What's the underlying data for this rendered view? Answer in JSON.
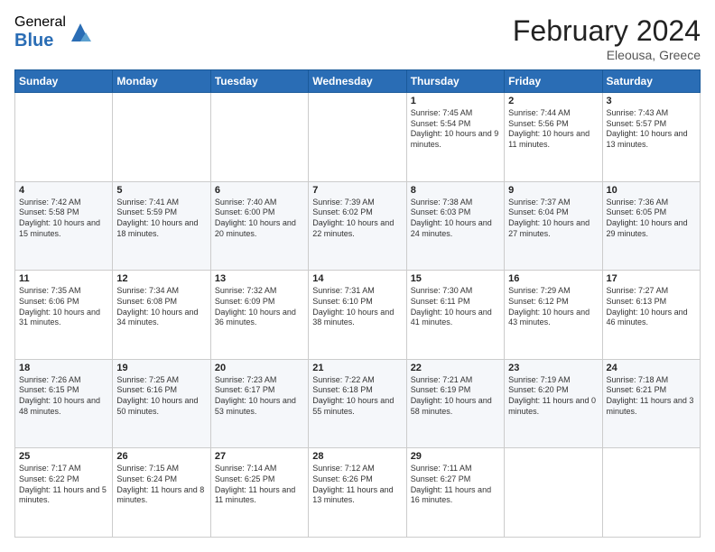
{
  "logo": {
    "general": "General",
    "blue": "Blue"
  },
  "title": "February 2024",
  "subtitle": "Eleousa, Greece",
  "days": [
    "Sunday",
    "Monday",
    "Tuesday",
    "Wednesday",
    "Thursday",
    "Friday",
    "Saturday"
  ],
  "weeks": [
    [
      {
        "num": "",
        "info": ""
      },
      {
        "num": "",
        "info": ""
      },
      {
        "num": "",
        "info": ""
      },
      {
        "num": "",
        "info": ""
      },
      {
        "num": "1",
        "info": "Sunrise: 7:45 AM\nSunset: 5:54 PM\nDaylight: 10 hours and 9 minutes."
      },
      {
        "num": "2",
        "info": "Sunrise: 7:44 AM\nSunset: 5:56 PM\nDaylight: 10 hours and 11 minutes."
      },
      {
        "num": "3",
        "info": "Sunrise: 7:43 AM\nSunset: 5:57 PM\nDaylight: 10 hours and 13 minutes."
      }
    ],
    [
      {
        "num": "4",
        "info": "Sunrise: 7:42 AM\nSunset: 5:58 PM\nDaylight: 10 hours and 15 minutes."
      },
      {
        "num": "5",
        "info": "Sunrise: 7:41 AM\nSunset: 5:59 PM\nDaylight: 10 hours and 18 minutes."
      },
      {
        "num": "6",
        "info": "Sunrise: 7:40 AM\nSunset: 6:00 PM\nDaylight: 10 hours and 20 minutes."
      },
      {
        "num": "7",
        "info": "Sunrise: 7:39 AM\nSunset: 6:02 PM\nDaylight: 10 hours and 22 minutes."
      },
      {
        "num": "8",
        "info": "Sunrise: 7:38 AM\nSunset: 6:03 PM\nDaylight: 10 hours and 24 minutes."
      },
      {
        "num": "9",
        "info": "Sunrise: 7:37 AM\nSunset: 6:04 PM\nDaylight: 10 hours and 27 minutes."
      },
      {
        "num": "10",
        "info": "Sunrise: 7:36 AM\nSunset: 6:05 PM\nDaylight: 10 hours and 29 minutes."
      }
    ],
    [
      {
        "num": "11",
        "info": "Sunrise: 7:35 AM\nSunset: 6:06 PM\nDaylight: 10 hours and 31 minutes."
      },
      {
        "num": "12",
        "info": "Sunrise: 7:34 AM\nSunset: 6:08 PM\nDaylight: 10 hours and 34 minutes."
      },
      {
        "num": "13",
        "info": "Sunrise: 7:32 AM\nSunset: 6:09 PM\nDaylight: 10 hours and 36 minutes."
      },
      {
        "num": "14",
        "info": "Sunrise: 7:31 AM\nSunset: 6:10 PM\nDaylight: 10 hours and 38 minutes."
      },
      {
        "num": "15",
        "info": "Sunrise: 7:30 AM\nSunset: 6:11 PM\nDaylight: 10 hours and 41 minutes."
      },
      {
        "num": "16",
        "info": "Sunrise: 7:29 AM\nSunset: 6:12 PM\nDaylight: 10 hours and 43 minutes."
      },
      {
        "num": "17",
        "info": "Sunrise: 7:27 AM\nSunset: 6:13 PM\nDaylight: 10 hours and 46 minutes."
      }
    ],
    [
      {
        "num": "18",
        "info": "Sunrise: 7:26 AM\nSunset: 6:15 PM\nDaylight: 10 hours and 48 minutes."
      },
      {
        "num": "19",
        "info": "Sunrise: 7:25 AM\nSunset: 6:16 PM\nDaylight: 10 hours and 50 minutes."
      },
      {
        "num": "20",
        "info": "Sunrise: 7:23 AM\nSunset: 6:17 PM\nDaylight: 10 hours and 53 minutes."
      },
      {
        "num": "21",
        "info": "Sunrise: 7:22 AM\nSunset: 6:18 PM\nDaylight: 10 hours and 55 minutes."
      },
      {
        "num": "22",
        "info": "Sunrise: 7:21 AM\nSunset: 6:19 PM\nDaylight: 10 hours and 58 minutes."
      },
      {
        "num": "23",
        "info": "Sunrise: 7:19 AM\nSunset: 6:20 PM\nDaylight: 11 hours and 0 minutes."
      },
      {
        "num": "24",
        "info": "Sunrise: 7:18 AM\nSunset: 6:21 PM\nDaylight: 11 hours and 3 minutes."
      }
    ],
    [
      {
        "num": "25",
        "info": "Sunrise: 7:17 AM\nSunset: 6:22 PM\nDaylight: 11 hours and 5 minutes."
      },
      {
        "num": "26",
        "info": "Sunrise: 7:15 AM\nSunset: 6:24 PM\nDaylight: 11 hours and 8 minutes."
      },
      {
        "num": "27",
        "info": "Sunrise: 7:14 AM\nSunset: 6:25 PM\nDaylight: 11 hours and 11 minutes."
      },
      {
        "num": "28",
        "info": "Sunrise: 7:12 AM\nSunset: 6:26 PM\nDaylight: 11 hours and 13 minutes."
      },
      {
        "num": "29",
        "info": "Sunrise: 7:11 AM\nSunset: 6:27 PM\nDaylight: 11 hours and 16 minutes."
      },
      {
        "num": "",
        "info": ""
      },
      {
        "num": "",
        "info": ""
      }
    ]
  ]
}
